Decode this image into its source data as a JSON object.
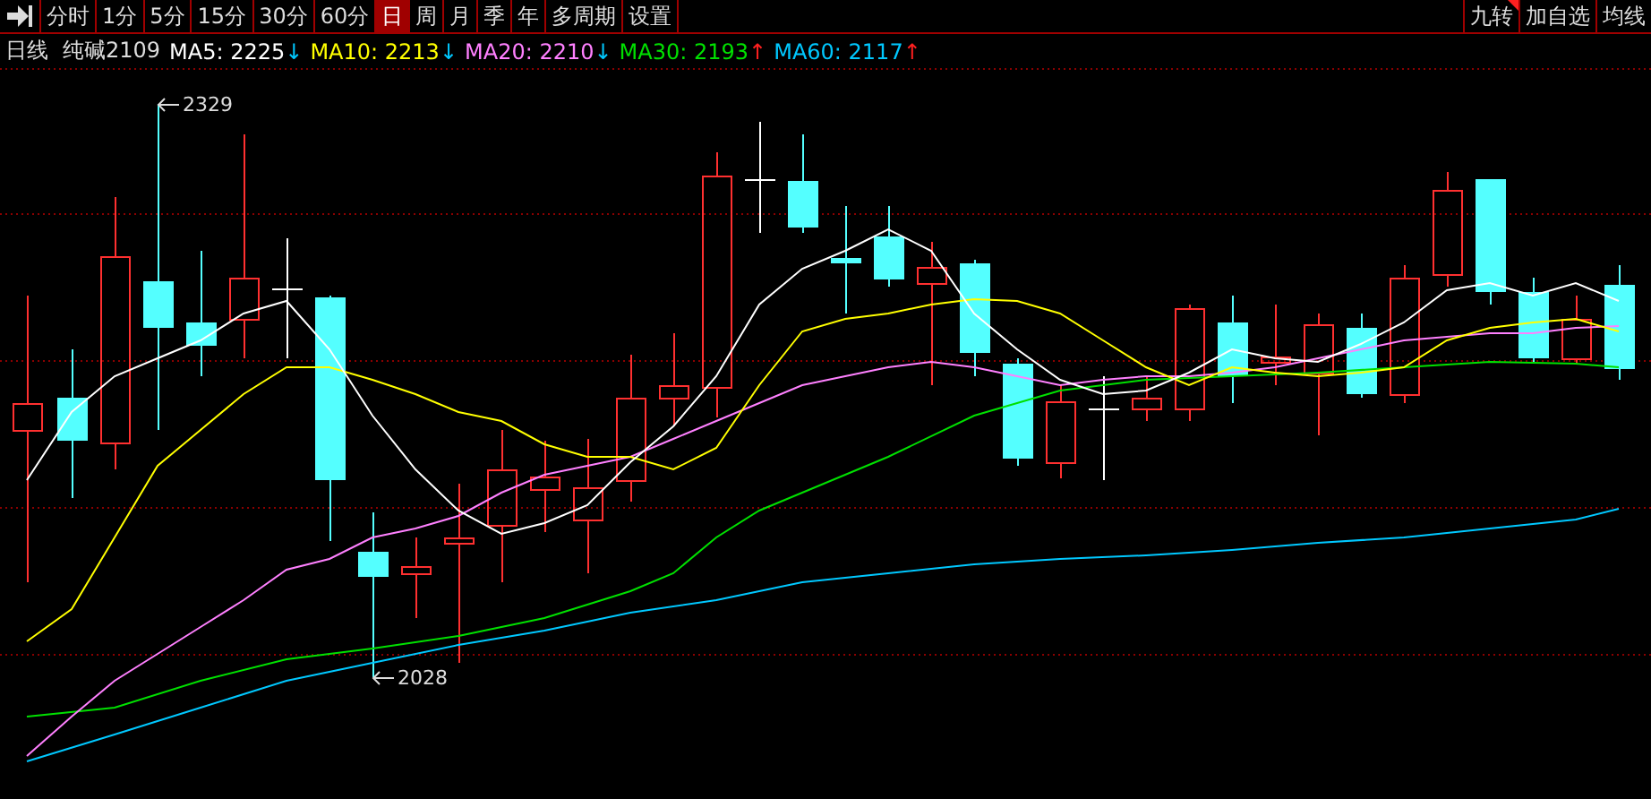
{
  "toolbar": {
    "tabs": [
      {
        "label": "分时",
        "selected": false
      },
      {
        "label": "1分",
        "selected": false
      },
      {
        "label": "5分",
        "selected": false
      },
      {
        "label": "15分",
        "selected": false
      },
      {
        "label": "30分",
        "selected": false
      },
      {
        "label": "60分",
        "selected": false
      },
      {
        "label": "日",
        "selected": true
      },
      {
        "label": "周",
        "selected": false
      },
      {
        "label": "月",
        "selected": false
      },
      {
        "label": "季",
        "selected": false
      },
      {
        "label": "年",
        "selected": false
      },
      {
        "label": "多周期",
        "selected": false
      },
      {
        "label": "设置",
        "selected": false
      }
    ],
    "right_buttons": [
      {
        "label": "九转",
        "flagged": true
      },
      {
        "label": "加自选",
        "flagged": false
      },
      {
        "label": "均线",
        "flagged": false
      }
    ]
  },
  "info": {
    "period": "日线",
    "symbol": "纯碱2109",
    "averages": [
      {
        "label": "MA5:",
        "value": "2225",
        "color": "#ffffff",
        "arrow": {
          "glyph": "↓",
          "color": "#00c8ff"
        }
      },
      {
        "label": "MA10:",
        "value": "2213",
        "color": "#ffff00",
        "arrow": {
          "glyph": "↓",
          "color": "#00c8ff"
        }
      },
      {
        "label": "MA20:",
        "value": "2210",
        "color": "#ff80ff",
        "arrow": {
          "glyph": "↓",
          "color": "#00c8ff"
        }
      },
      {
        "label": "MA30:",
        "value": "2193",
        "color": "#00e000",
        "arrow": {
          "glyph": "↑",
          "color": "#ff2020"
        }
      },
      {
        "label": "MA60:",
        "value": "2117",
        "color": "#00c8ff",
        "arrow": {
          "glyph": "↑",
          "color": "#ff2020"
        }
      }
    ]
  },
  "chart": {
    "high_label": "2329",
    "low_label": "2028"
  }
}
